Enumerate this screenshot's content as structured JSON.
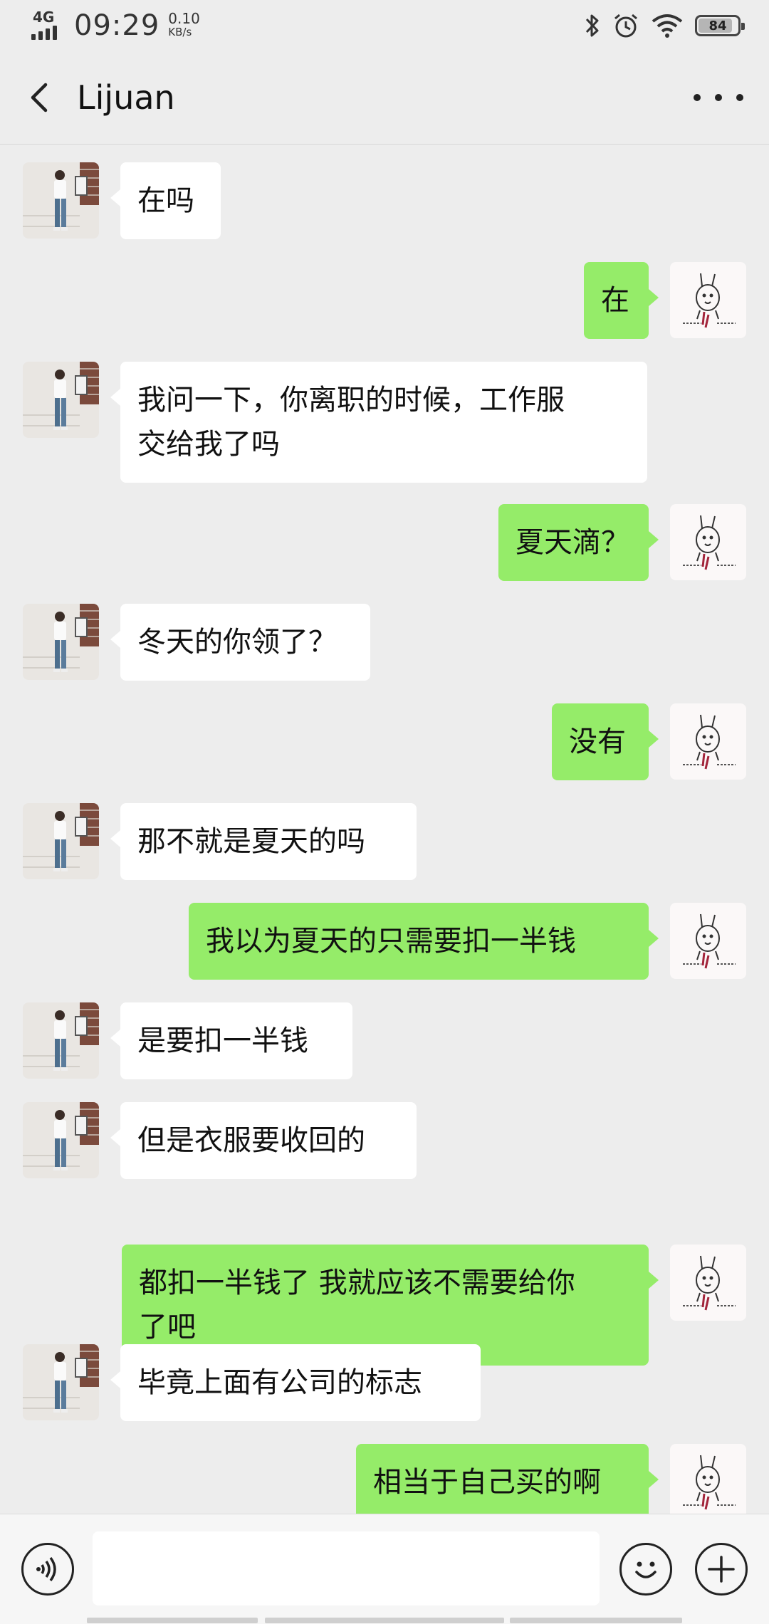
{
  "status_bar": {
    "network": "4G",
    "time": "09:29",
    "speed_value": "0.10",
    "speed_unit": "KB/s",
    "battery": "84",
    "battery_level": 0.84,
    "icons": [
      "bluetooth-icon",
      "alarm-icon",
      "wifi-icon",
      "battery-icon"
    ]
  },
  "header": {
    "title": "Lijuan",
    "back_icon": "chevron-left-icon",
    "more_icon": "more-dots-icon"
  },
  "messages": [
    {
      "from": "other",
      "text": "在吗"
    },
    {
      "from": "me",
      "text": "在"
    },
    {
      "from": "other",
      "text": "我问一下，你离职的时候，工作服\n交给我了吗"
    },
    {
      "from": "me",
      "text": "夏天滴？"
    },
    {
      "from": "other",
      "text": "冬天的你领了？"
    },
    {
      "from": "me",
      "text": "没有"
    },
    {
      "from": "other",
      "text": "那不就是夏天的吗"
    },
    {
      "from": "me",
      "text": "我以为夏天的只需要扣一半钱"
    },
    {
      "from": "other",
      "text": "是要扣一半钱"
    },
    {
      "from": "other",
      "text": "但是衣服要收回的"
    },
    {
      "from": "me",
      "text": "都扣一半钱了 我就应该不需要给你\n了吧"
    },
    {
      "from": "other",
      "text": "毕竟上面有公司的标志"
    },
    {
      "from": "me",
      "text": "相当于自己买的啊"
    }
  ],
  "input_bar": {
    "input_value": "",
    "icons": [
      "voice-icon",
      "emoji-icon",
      "plus-icon"
    ]
  },
  "colors": {
    "background": "#ededed",
    "bubble_out": "#95ec69",
    "bubble_in": "#ffffff"
  }
}
